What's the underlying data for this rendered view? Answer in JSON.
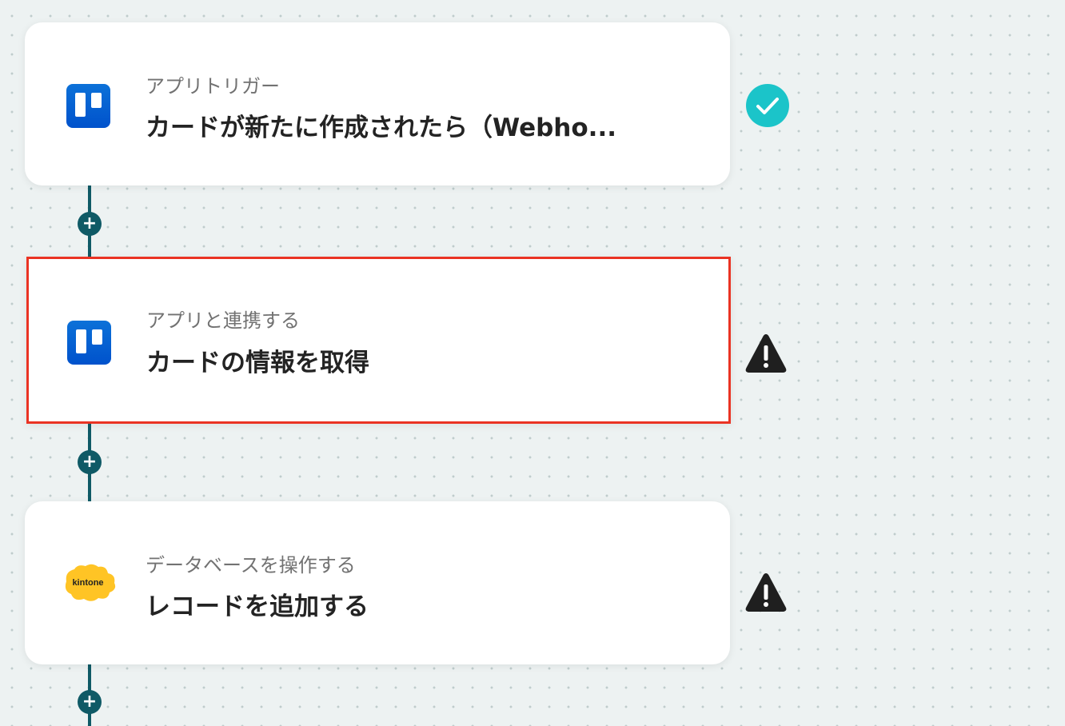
{
  "workflow": {
    "steps": [
      {
        "app_icon": "trello-icon",
        "label": "アプリトリガー",
        "title": "カードが新たに作成されたら（Webho...",
        "status": "check-icon"
      },
      {
        "app_icon": "trello-icon",
        "label": "アプリと連携する",
        "title": "カードの情報を取得",
        "status": "warning-icon",
        "selected": true
      },
      {
        "app_icon": "kintone-icon",
        "app_icon_text": "kintone",
        "label": "データベースを操作する",
        "title": "レコードを追加する",
        "status": "warning-icon"
      }
    ],
    "add_step_icon": "plus-icon",
    "add_step_symbol": "+"
  },
  "colors": {
    "connector": "#0f5a66",
    "selected_border": "#ea3323",
    "check_badge": "#1bc4c9",
    "warning": "#1f1f1f",
    "trello_blue": "#0052cc",
    "kintone_yellow": "#ffc425",
    "background": "#edf2f2"
  }
}
